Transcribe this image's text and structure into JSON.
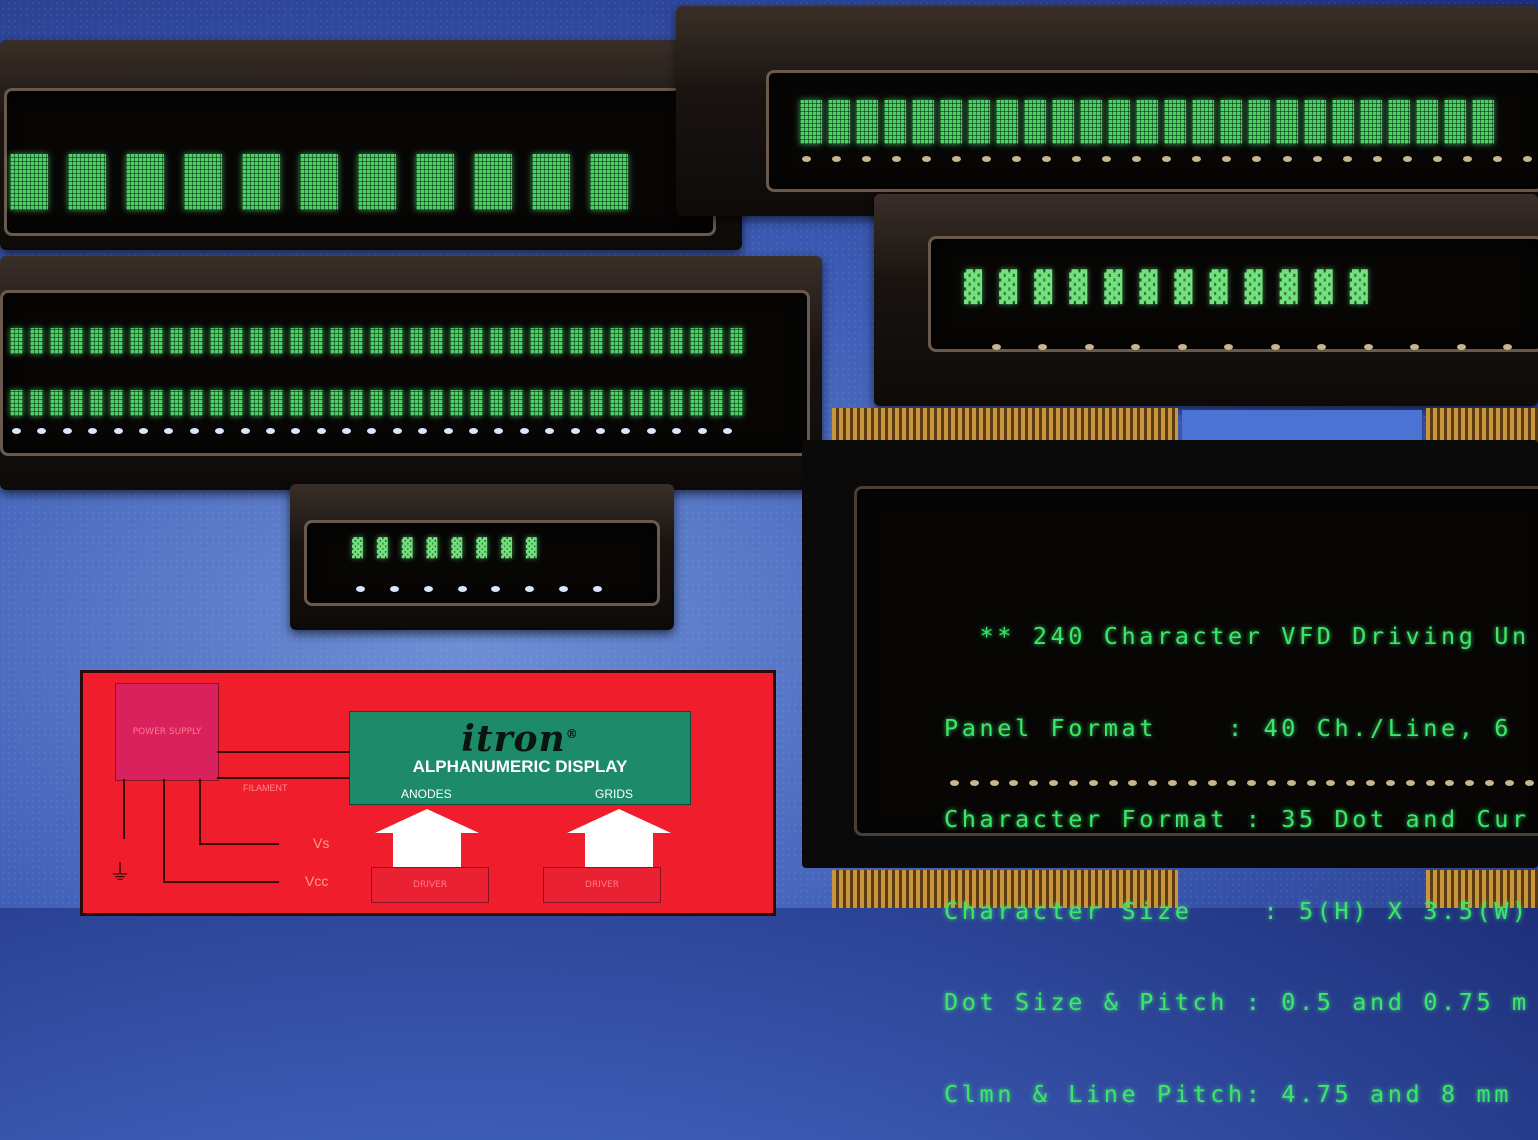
{
  "vfd_screen": {
    "lines": [
      "  ** 240 Character VFD Driving Un",
      "Panel Format    : 40 Ch./Line, 6",
      "Character Format : 35 Dot and Cur",
      "Character Size    : 5(H) X 3.5(W)",
      "Dot Size & Pitch : 0.5 and 0.75 m",
      "Clmn & Line Pitch: 4.75 and 8 mm"
    ]
  },
  "diagram": {
    "brand": "itron",
    "display_label": "ALPHANUMERIC DISPLAY",
    "anodes": "ANODES",
    "grids": "GRIDS",
    "power_supply": "POWER SUPPLY",
    "filament": "FILAMENT",
    "vs": "Vs",
    "vcc": "Vcc",
    "driver_1": "DRIVER",
    "driver_2": "DRIVER"
  },
  "colors": {
    "vfd_green": "#39e86a",
    "diagram_red": "#f01e2c",
    "display_teal": "#1d8a6a"
  }
}
